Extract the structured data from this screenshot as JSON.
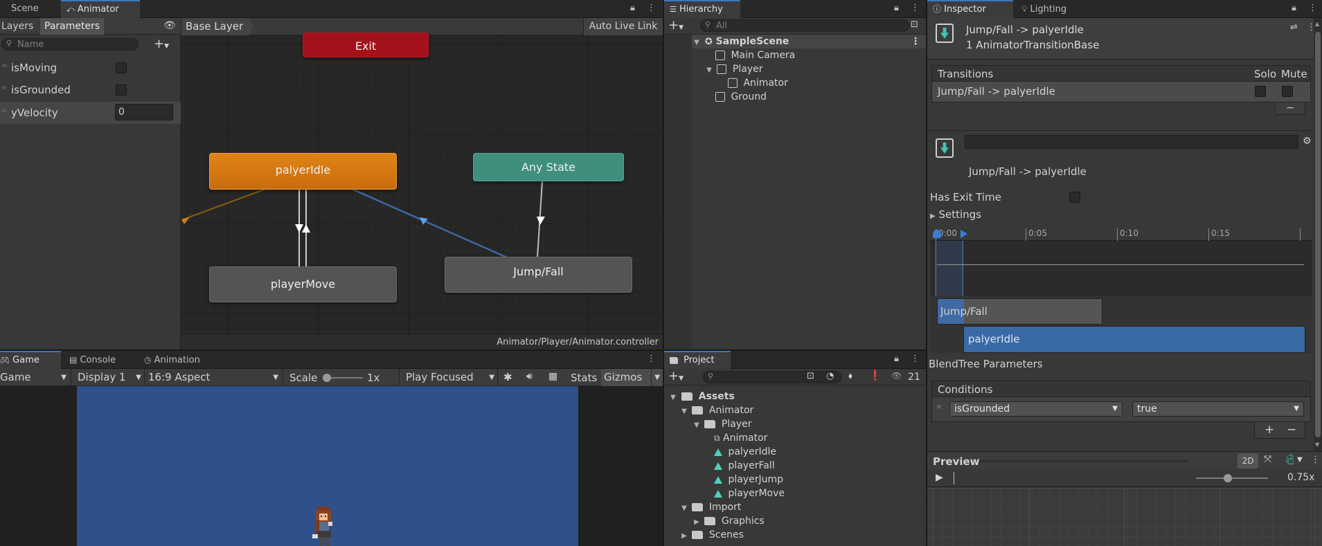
{
  "animator_panel": {
    "tabs": [
      {
        "label": "Scene"
      },
      {
        "label": "Animator"
      }
    ],
    "subtabs": {
      "layers": "Layers",
      "parameters": "Parameters"
    },
    "search_placeholder": "Name",
    "breadcrumb": "Base Layer",
    "auto_live_link": "Auto Live Link",
    "parameters": [
      {
        "name": "isMoving",
        "type": "bool",
        "value": false
      },
      {
        "name": "isGrounded",
        "type": "bool",
        "value": false
      },
      {
        "name": "yVelocity",
        "type": "float",
        "value": "0"
      }
    ],
    "states": {
      "exit": "Exit",
      "idle": "palyerIdle",
      "any": "Any State",
      "move": "playerMove",
      "jumpfall": "Jump/Fall"
    },
    "controller_path": "Animator/Player/Animator.controller"
  },
  "game_panel": {
    "tabs": [
      {
        "label": "Game"
      },
      {
        "label": "Console"
      },
      {
        "label": "Animation"
      }
    ],
    "toolbar": {
      "mode": "Game",
      "display": "Display 1",
      "aspect": "16:9 Aspect",
      "scale_label": "Scale",
      "scale_value": "1x",
      "play_mode": "Play Focused",
      "stats": "Stats",
      "gizmos": "Gizmos"
    },
    "background_color": "#2f5088"
  },
  "hierarchy": {
    "tab": "Hierarchy",
    "search_placeholder": "All",
    "items": [
      {
        "label": "SampleScene"
      },
      {
        "label": "Main Camera"
      },
      {
        "label": "Player"
      },
      {
        "label": "Animator"
      },
      {
        "label": "Ground"
      }
    ]
  },
  "project": {
    "tab": "Project",
    "count": "21",
    "items": [
      {
        "label": "Assets"
      },
      {
        "label": "Animator"
      },
      {
        "label": "Player"
      },
      {
        "label": "Animator"
      },
      {
        "label": "palyerIdle"
      },
      {
        "label": "playerFall"
      },
      {
        "label": "playerJump"
      },
      {
        "label": "playerMove"
      },
      {
        "label": "Import"
      },
      {
        "label": "Graphics"
      },
      {
        "label": "Scenes"
      }
    ]
  },
  "inspector": {
    "tabs": [
      {
        "label": "Inspector"
      },
      {
        "label": "Lighting"
      }
    ],
    "title": "Jump/Fall -> palyerIdle",
    "subtitle": "1 AnimatorTransitionBase",
    "transitions_header": "Transitions",
    "solo": "Solo",
    "mute": "Mute",
    "transition_row": "Jump/Fall -> palyerIdle",
    "transition_name": "Jump/Fall -> palyerIdle",
    "has_exit_time": "Has Exit Time",
    "settings": "Settings",
    "timeline_ticks": [
      "0:00",
      "0:05",
      "0:10",
      "0:15"
    ],
    "timeline_bars": {
      "from": "Jump/Fall",
      "to": "palyerIdle"
    },
    "blendtree_params": "BlendTree Parameters",
    "conditions_header": "Conditions",
    "condition": {
      "parameter": "isGrounded",
      "value": "true"
    },
    "preview": "Preview",
    "preview_2d": "2D",
    "preview_speed": "0.75x"
  }
}
